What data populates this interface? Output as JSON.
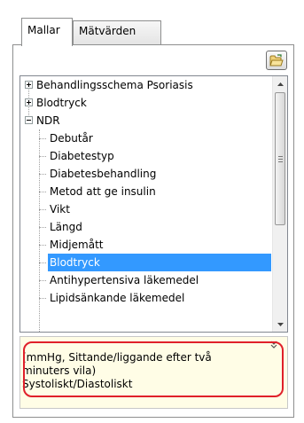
{
  "tabs": [
    {
      "label": "Mallar",
      "active": true
    },
    {
      "label": "Mätvärden",
      "active": false
    }
  ],
  "tree": {
    "items": [
      {
        "label": "Behandlingsschema Psoriasis",
        "level": 0,
        "expander": "plus"
      },
      {
        "label": "Blodtryck",
        "level": 0,
        "expander": "plus"
      },
      {
        "label": "NDR",
        "level": 0,
        "expander": "minus"
      },
      {
        "label": "Debutår",
        "level": 1
      },
      {
        "label": "Diabetestyp",
        "level": 1
      },
      {
        "label": "Diabetesbehandling",
        "level": 1
      },
      {
        "label": "Metod att ge insulin",
        "level": 1
      },
      {
        "label": "Vikt",
        "level": 1
      },
      {
        "label": "Längd",
        "level": 1
      },
      {
        "label": "Midjemått",
        "level": 1
      },
      {
        "label": "Blodtryck",
        "level": 1,
        "selected": true
      },
      {
        "label": "Antihypertensiva läkemedel",
        "level": 1
      },
      {
        "label": "Lipidsänkande läkemedel",
        "level": 1
      }
    ]
  },
  "info": {
    "line1": "(mmHg, Sittande/liggande efter två",
    "line2": "minuters vila)",
    "line3": "Systoliskt/Diastoliskt"
  },
  "colors": {
    "selection": "#3399ff",
    "info_background": "#fffde6",
    "highlight_border": "#e0202a"
  },
  "icons": {
    "open_button": "open-folder-icon",
    "scroll_up": "arrow-up-icon",
    "scroll_down": "arrow-down-icon",
    "more": "double-chevron-down-icon"
  }
}
